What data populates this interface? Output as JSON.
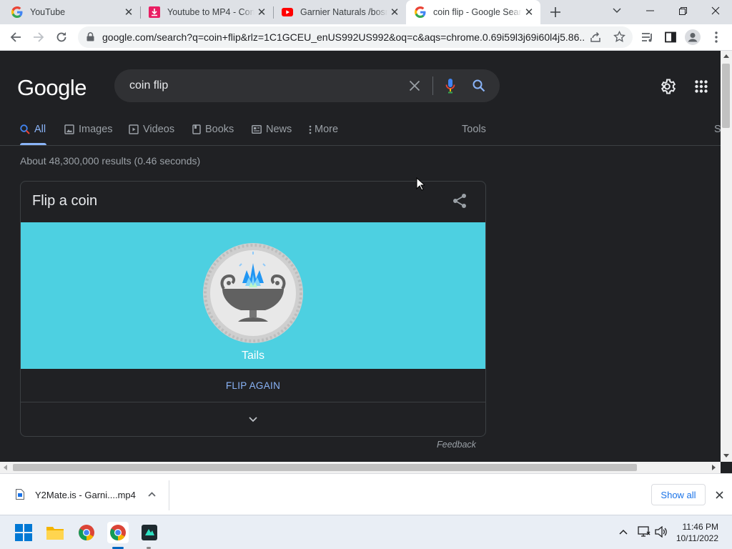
{
  "tabs": [
    {
      "title": "YouTube",
      "icon": "google-g-icon"
    },
    {
      "title": "Youtube to MP4 - Conv",
      "icon": "download-icon"
    },
    {
      "title": "Garnier Naturals /bosn",
      "icon": "youtube-icon"
    },
    {
      "title": "coin flip - Google Sear",
      "icon": "google-g-icon",
      "active": true
    }
  ],
  "toolbar": {
    "url": "google.com/search?q=coin+flip&rlz=1C1GCEU_enUS992US992&oq=c&aqs=chrome.0.69i59l3j69i60l4j5.86..."
  },
  "search": {
    "logo": "Google",
    "query": "coin flip"
  },
  "nav": {
    "tabs": [
      "All",
      "Images",
      "Videos",
      "Books",
      "News",
      "More"
    ],
    "tools": "Tools",
    "partial": "S"
  },
  "results": {
    "stats": "About 48,300,000 results (0.46 seconds)"
  },
  "coin_card": {
    "title": "Flip a coin",
    "result": "Tails",
    "flip_again": "FLIP AGAIN",
    "feedback": "Feedback",
    "panel_color": "#4dd0e1"
  },
  "downloads": {
    "file": "Y2Mate.is - Garni....mp4",
    "show_all": "Show all"
  },
  "taskbar": {
    "time": "11:46 PM",
    "date": "10/11/2022"
  },
  "colors": {
    "page_bg": "#202124",
    "link": "#8ab4f8",
    "accent": "#1a73e8"
  }
}
